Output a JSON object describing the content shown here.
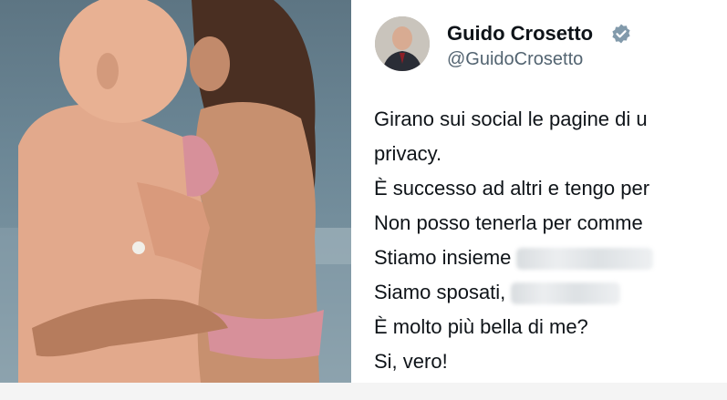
{
  "photo": {
    "description_icon": "photo-image"
  },
  "tweet": {
    "display_name": "Guido Crosetto",
    "handle": "@GuidoCrosetto",
    "verified_icon": "verified-badge-icon",
    "lines": [
      "Girano sui social le pagine di u",
      "privacy.",
      "È successo ad altri e tengo per",
      "Non posso tenerla per comme",
      "Stiamo insieme",
      "Siamo sposati,",
      "È molto più bella di me?",
      "Si, vero!"
    ]
  },
  "colors": {
    "verified": "#829aab",
    "text": "#0f1419",
    "handle": "#536471"
  }
}
